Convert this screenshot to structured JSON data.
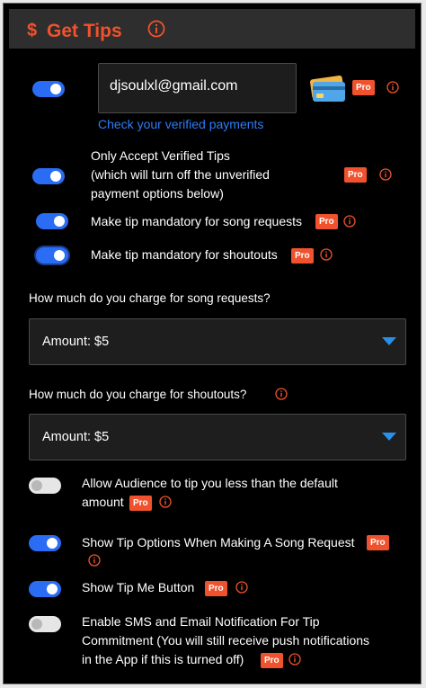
{
  "header": {
    "dollar": "$",
    "title": "Get Tips"
  },
  "badge": "Pro",
  "payment": {
    "email": "djsoulxl@gmail.com",
    "verify_link": "Check your verified payments"
  },
  "verified_tips": {
    "line1": "Only Accept Verified Tips",
    "line2": "(which will turn off the unverified",
    "line3": "payment options below)"
  },
  "mandatory_song": "Make tip mandatory for song requests",
  "mandatory_shoutout": "Make tip mandatory for shoutouts",
  "song_requests": {
    "question": "How much do you charge for song requests?",
    "amount": "Amount: $5"
  },
  "shoutouts": {
    "question": "How much do you charge for shoutouts?",
    "amount": "Amount: $5"
  },
  "allow_less": {
    "line1": "Allow Audience to tip you less than the default",
    "line2": "amount"
  },
  "show_tip_options": "Show Tip Options When Making A Song Request",
  "show_tip_me": "Show Tip Me Button",
  "sms_email": {
    "line1": "Enable SMS and Email Notification For Tip",
    "line2": "Commitment (You will still receive push notifications",
    "line3": "in the App if this is turned off)"
  },
  "colors": {
    "accent": "#f0522d",
    "toggle_on": "#2a6cf3",
    "link": "#2f7cf6"
  }
}
